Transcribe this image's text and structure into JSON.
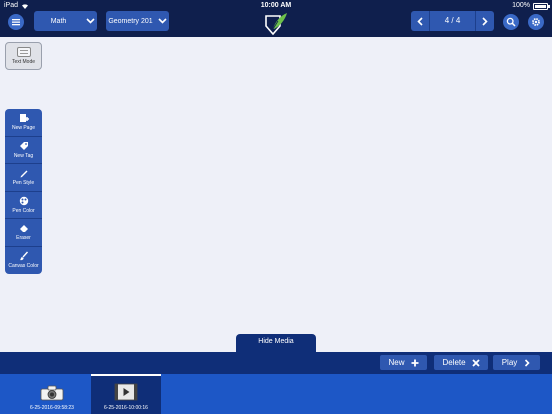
{
  "status_bar": {
    "device": "iPad",
    "time": "10:00 AM",
    "battery": "100%"
  },
  "header": {
    "subject_dropdown": "Math",
    "notebook_dropdown": "Geometry 201",
    "page_indicator": "4 / 4"
  },
  "text_mode": {
    "label": "Text Mode"
  },
  "toolbar": {
    "items": [
      {
        "label": "New Page",
        "icon": "new-page-icon"
      },
      {
        "label": "New Tag",
        "icon": "tag-icon"
      },
      {
        "label": "Pen Style",
        "icon": "pen-icon"
      },
      {
        "label": "Pen Color",
        "icon": "palette-icon"
      },
      {
        "label": "Eraser",
        "icon": "eraser-icon"
      },
      {
        "label": "Canvas Color",
        "icon": "brush-icon"
      }
    ]
  },
  "media_panel": {
    "toggle_label": "Hide Media",
    "actions": {
      "new_label": "New",
      "delete_label": "Delete",
      "play_label": "Play"
    },
    "items": [
      {
        "timestamp": "6-25-2016-09:58:23",
        "type": "camera-icon",
        "selected": false
      },
      {
        "timestamp": "6-25-2016-10:00:16",
        "type": "video-icon",
        "selected": true
      }
    ]
  },
  "colors": {
    "navy": "#0f1f4d",
    "accent_blue": "#2f58b0",
    "media_strip": "#1d57c6",
    "canvas": "#eef0f8"
  }
}
